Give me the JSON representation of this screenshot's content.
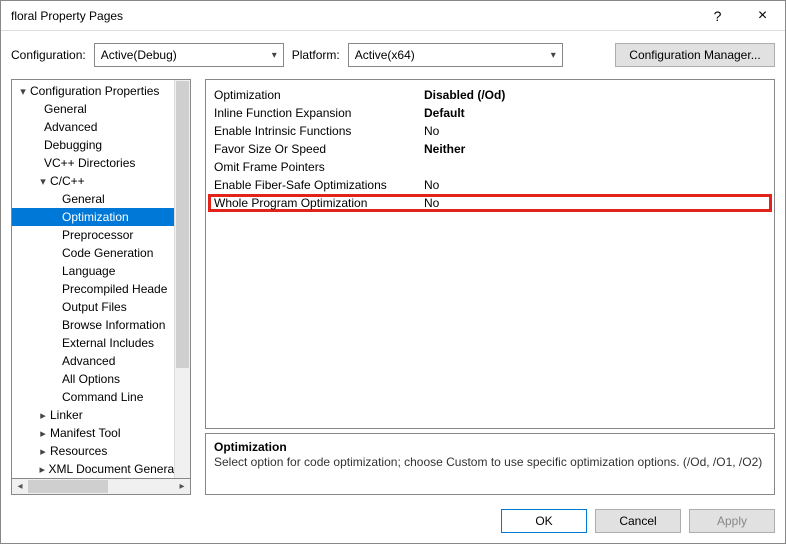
{
  "window": {
    "title": "floral Property Pages"
  },
  "toolbar": {
    "config_label": "Configuration:",
    "config_value": "Active(Debug)",
    "platform_label": "Platform:",
    "platform_value": "Active(x64)",
    "manager_label": "Configuration Manager..."
  },
  "tree": {
    "root": "Configuration Properties",
    "root_children": [
      "General",
      "Advanced",
      "Debugging",
      "VC++ Directories"
    ],
    "ccpp": "C/C++",
    "ccpp_children": [
      "General",
      "Optimization",
      "Preprocessor",
      "Code Generation",
      "Language",
      "Precompiled Heade",
      "Output Files",
      "Browse Information",
      "External Includes",
      "Advanced",
      "All Options",
      "Command Line"
    ],
    "selected": "Optimization",
    "after": [
      "Linker",
      "Manifest Tool",
      "Resources",
      "XML Document Genera"
    ]
  },
  "grid": [
    {
      "k": "Optimization",
      "v": "Disabled (/Od)",
      "bold": true
    },
    {
      "k": "Inline Function Expansion",
      "v": "Default",
      "bold": true
    },
    {
      "k": "Enable Intrinsic Functions",
      "v": "No"
    },
    {
      "k": "Favor Size Or Speed",
      "v": "Neither",
      "bold": true
    },
    {
      "k": "Omit Frame Pointers",
      "v": ""
    },
    {
      "k": "Enable Fiber-Safe Optimizations",
      "v": "No"
    },
    {
      "k": "Whole Program Optimization",
      "v": "No",
      "hl": true
    }
  ],
  "desc": {
    "title": "Optimization",
    "body": "Select option for code optimization; choose Custom to use specific optimization options.     (/Od, /O1, /O2)"
  },
  "footer": {
    "ok": "OK",
    "cancel": "Cancel",
    "apply": "Apply"
  }
}
